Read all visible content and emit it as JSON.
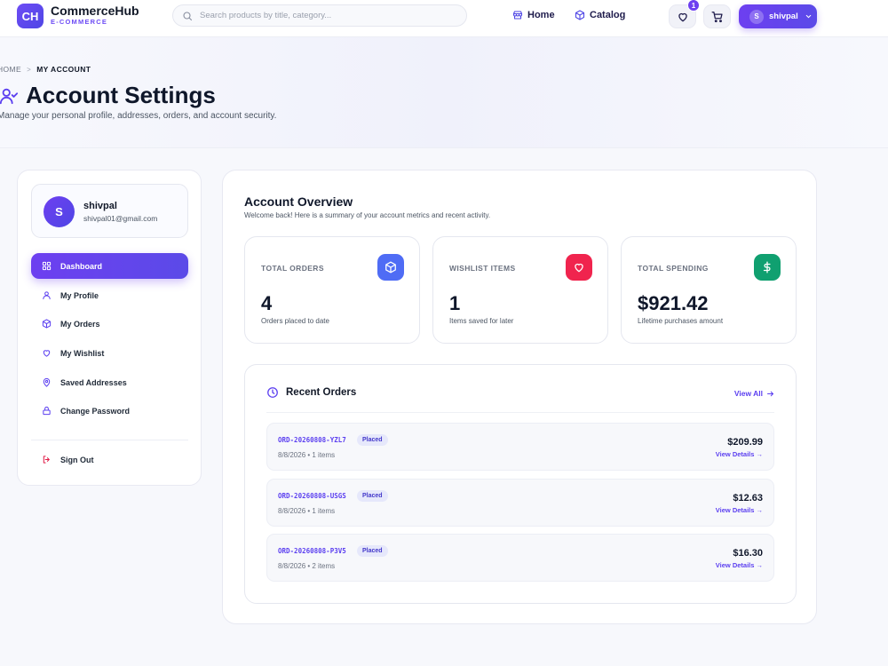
{
  "brand": {
    "badge": "CH",
    "name": "CommerceHub",
    "tagline": "E-COMMERCE"
  },
  "search": {
    "placeholder": "Search products by title, category..."
  },
  "nav": {
    "home": "Home",
    "catalog": "Catalog",
    "wishlist_count": "1",
    "user_initial": "S",
    "user_name": "shivpal"
  },
  "breadcrumb": {
    "home": "HOME",
    "separator": ">",
    "current": "MY ACCOUNT"
  },
  "page": {
    "title": "Account Settings",
    "subtitle": "Manage your personal profile, addresses, orders, and account security."
  },
  "profile": {
    "initial": "S",
    "name": "shivpal",
    "email": "shivpal01@gmail.com"
  },
  "sidebar": {
    "items": [
      {
        "label": "Dashboard",
        "icon": "grid-icon"
      },
      {
        "label": "My Profile",
        "icon": "user-icon"
      },
      {
        "label": "My Orders",
        "icon": "box-icon"
      },
      {
        "label": "My Wishlist",
        "icon": "heart-icon"
      },
      {
        "label": "Saved Addresses",
        "icon": "map-pin-icon"
      },
      {
        "label": "Change Password",
        "icon": "lock-icon"
      }
    ],
    "signout": "Sign Out"
  },
  "overview": {
    "title": "Account Overview",
    "subtitle": "Welcome back! Here is a summary of your account metrics and recent activity."
  },
  "stats": [
    {
      "label": "TOTAL ORDERS",
      "value": "4",
      "caption": "Orders placed to date",
      "icon": "box-icon",
      "color": "#4f6cf5"
    },
    {
      "label": "WISHLIST ITEMS",
      "value": "1",
      "caption": "Items saved for later",
      "icon": "heart-icon",
      "color": "#f0244e"
    },
    {
      "label": "TOTAL SPENDING",
      "value": "$921.42",
      "caption": "Lifetime purchases amount",
      "icon": "dollar-icon",
      "color": "#10a070"
    }
  ],
  "recent": {
    "title": "Recent Orders",
    "view_all": "View All",
    "orders": [
      {
        "id": "ORD-20260808-YZL7",
        "status": "Placed",
        "meta": "8/8/2026 • 1 items",
        "total": "$209.99",
        "link": "View Details →"
      },
      {
        "id": "ORD-20260808-USGS",
        "status": "Placed",
        "meta": "8/8/2026 • 1 items",
        "total": "$12.63",
        "link": "View Details →"
      },
      {
        "id": "ORD-20260808-P3V5",
        "status": "Placed",
        "meta": "8/8/2026 • 2 items",
        "total": "$16.30",
        "link": "View Details →"
      }
    ]
  },
  "colors": {
    "accent": "#6d3ff0",
    "accent_dark": "#4f46e5",
    "background": "#f7f8fc"
  }
}
